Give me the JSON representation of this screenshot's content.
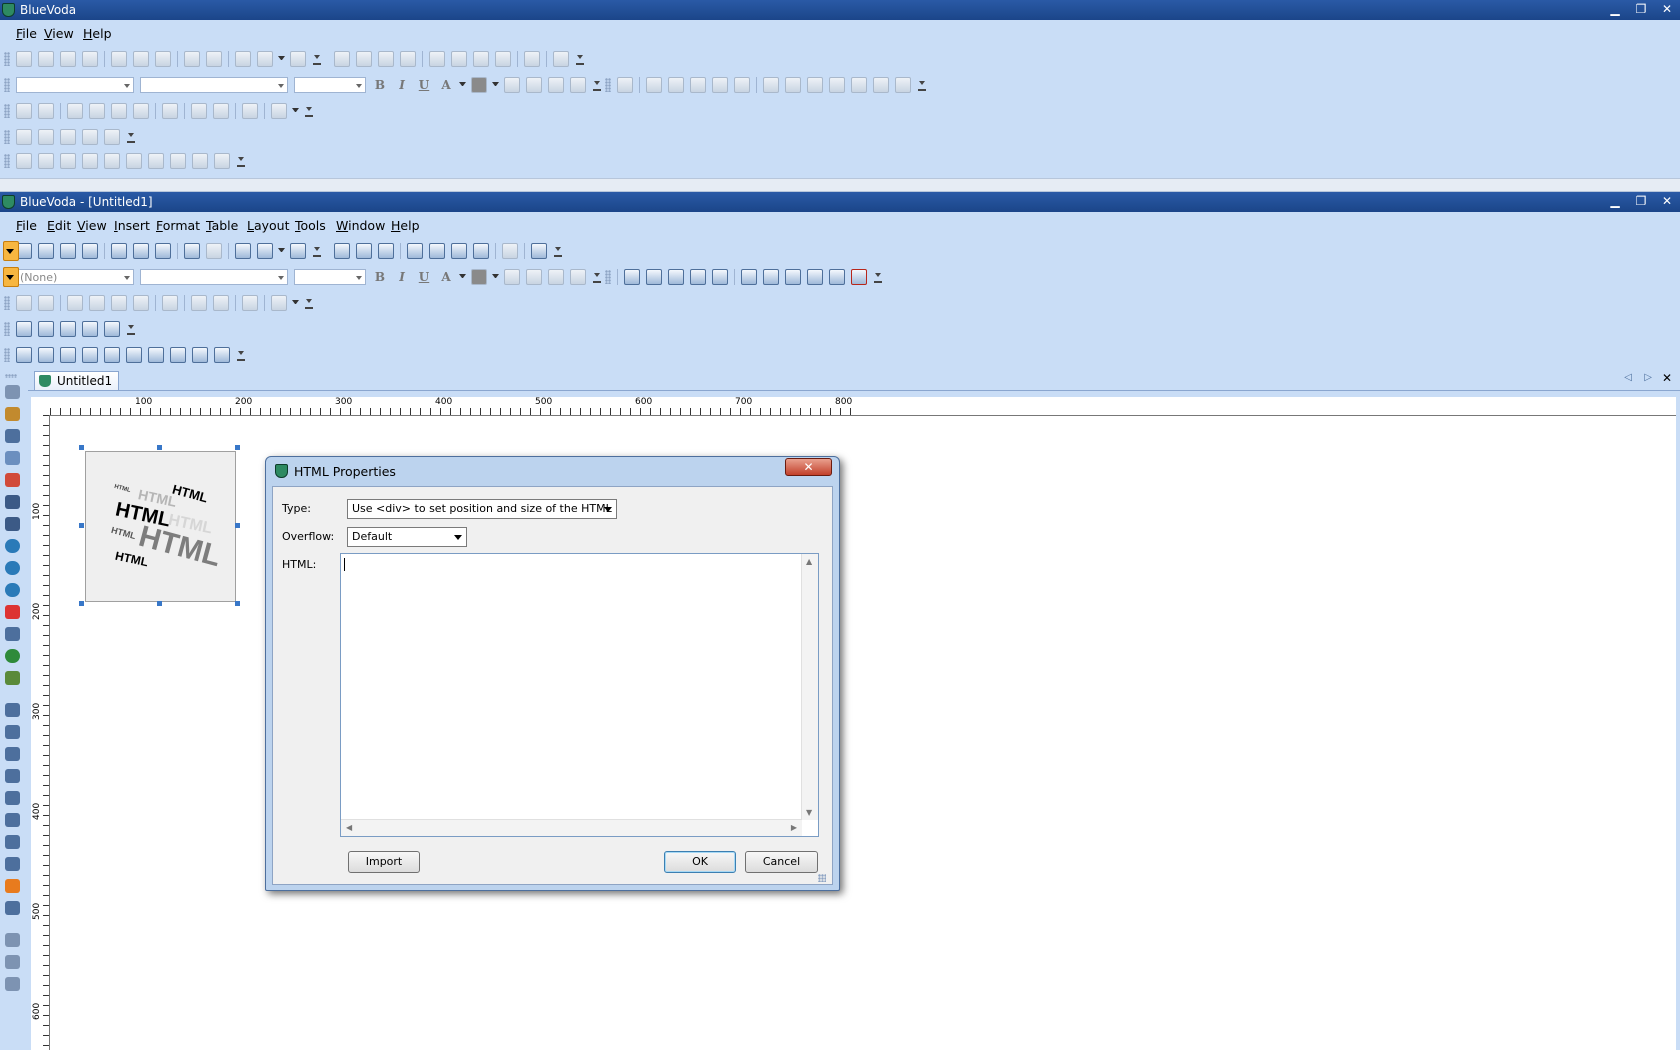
{
  "outer_window": {
    "title": "BlueVoda",
    "menu": [
      "File",
      "View",
      "Help"
    ],
    "controls": [
      "minimize",
      "restore",
      "close"
    ]
  },
  "inner_window": {
    "title": "BlueVoda - [Untitled1]",
    "menu": [
      "File",
      "Edit",
      "View",
      "Insert",
      "Format",
      "Table",
      "Layout",
      "Tools",
      "Window",
      "Help"
    ],
    "style_combo": "(None)"
  },
  "document_tab": {
    "label": "Untitled1"
  },
  "ruler": {
    "labels": [
      "100",
      "200",
      "300",
      "400",
      "500",
      "600",
      "700",
      "800"
    ],
    "v_labels": [
      "100",
      "200",
      "300",
      "400",
      "500",
      "600"
    ]
  },
  "html_object": {
    "words": [
      "HTML",
      "HTML",
      "HTML",
      "HTML",
      "HTML",
      "HTML",
      "HTML",
      "HTML"
    ]
  },
  "dialog": {
    "title": "HTML Properties",
    "close_label": "✕",
    "type_label": "Type:",
    "type_value": "Use <div> to set position and size of the HTML",
    "overflow_label": "Overflow:",
    "overflow_value": "Default",
    "html_label": "HTML:",
    "html_value": "",
    "import_label": "Import",
    "ok_label": "OK",
    "cancel_label": "Cancel"
  },
  "colors": {
    "title_bar": "#1b4589",
    "toolbar_bg": "#c9ddf6",
    "selected_tool": "#f7b640",
    "close_button": "#c2402b"
  }
}
